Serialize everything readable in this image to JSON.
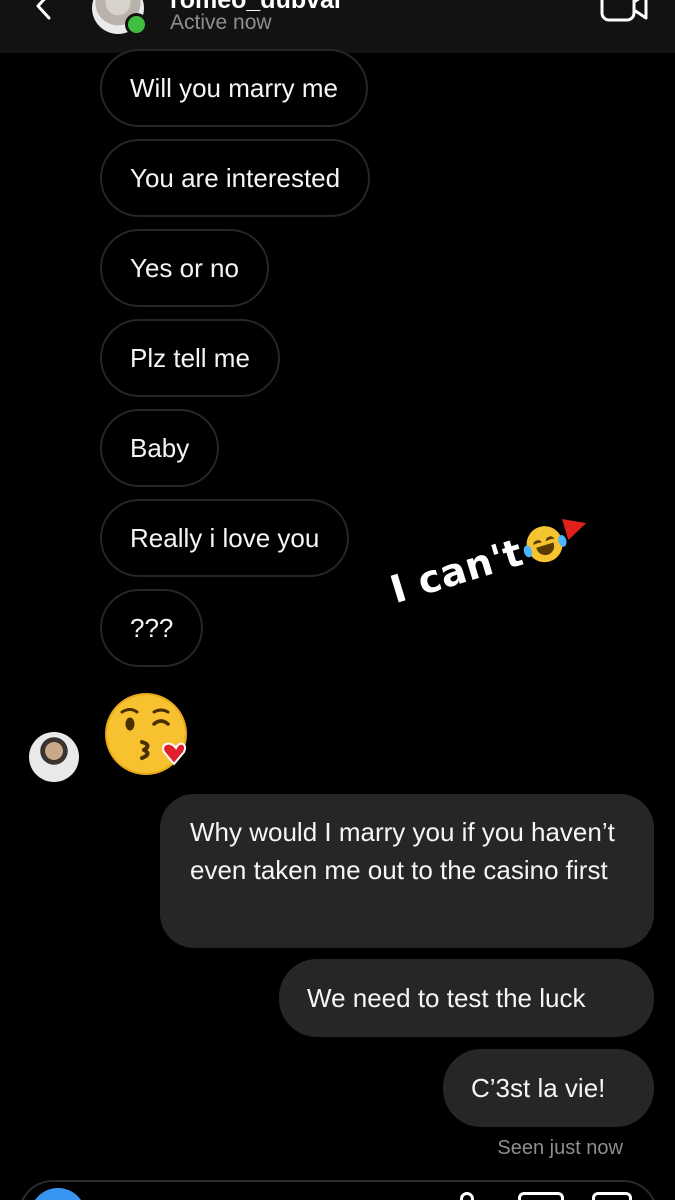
{
  "header": {
    "username": "romeo_dubvai",
    "status": "Active now"
  },
  "received_messages": [
    "Will you marry me",
    "You are interested",
    "Yes or no",
    "Plz tell me",
    "Baby",
    "Really i love you",
    "???"
  ],
  "sticker": {
    "text": "I can't"
  },
  "sent_messages": [
    "Why would I marry you if you haven’t even taken me out to the casino first",
    "We need to test the luck",
    "C’3st la vie!"
  ],
  "seen": "Seen just now",
  "colors": {
    "background": "#000000",
    "header": "#121212",
    "sent_bubble": "#262626",
    "received_border": "#262626",
    "online": "#3fbf3f",
    "muted_text": "#8e8e8e",
    "camera_button": "#3797f0"
  }
}
